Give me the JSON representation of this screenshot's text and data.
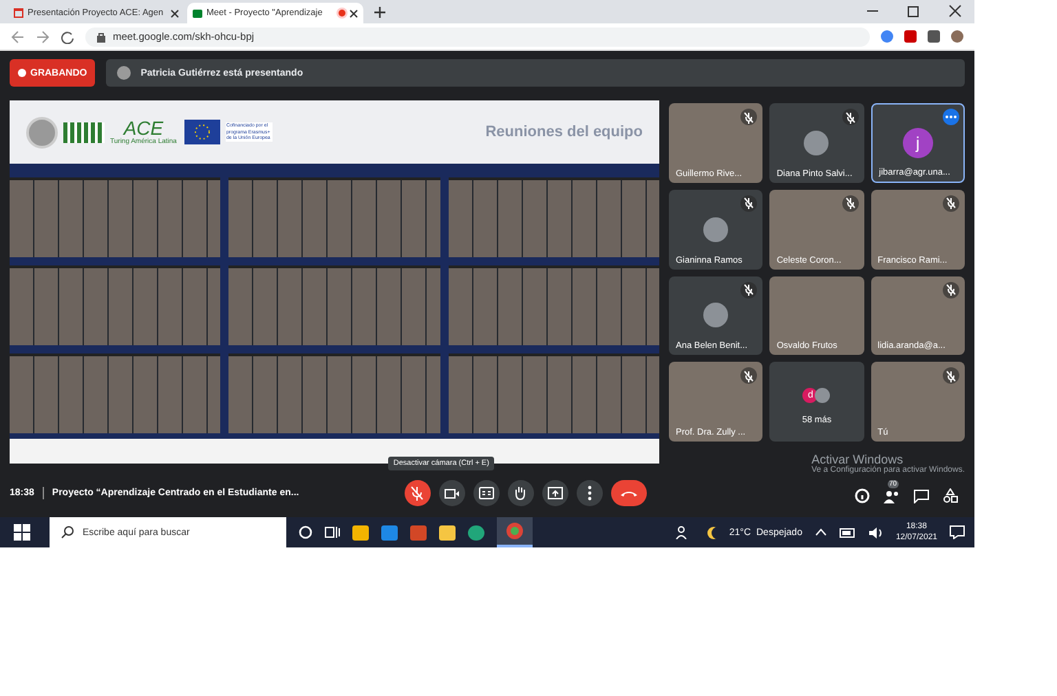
{
  "browser": {
    "tabs": [
      {
        "title": "Presentación Proyecto ACE: Agen",
        "selected": false
      },
      {
        "title": "Meet - Proyecto \"Aprendizaje",
        "selected": true
      }
    ],
    "url": "meet.google.com/skh-ohcu-bpj"
  },
  "meeting": {
    "recording_label": "GRABANDO",
    "presenter_text": "Patricia Gutiérrez está presentando"
  },
  "slide": {
    "logo_text": "ACE",
    "logo_subtitle": "Turing América Latina",
    "eu_text": "Cofinanciado por el programa Erasmus+ de la Unión Europea",
    "title": "Reuniones del equipo"
  },
  "participants": [
    {
      "name": "Guillermo Rive...",
      "kind": "video",
      "muted": true,
      "selected": false
    },
    {
      "name": "Diana Pinto Salvi...",
      "kind": "avatar",
      "muted": true,
      "selected": false
    },
    {
      "name": "jibarra@agr.una...",
      "kind": "letter",
      "letter": "j",
      "color": "#a142c4",
      "muted": false,
      "selected": true
    },
    {
      "name": "Gianinna Ramos",
      "kind": "avatar",
      "muted": true,
      "selected": false
    },
    {
      "name": "Celeste Coron...",
      "kind": "video",
      "muted": true,
      "selected": false
    },
    {
      "name": "Francisco Rami...",
      "kind": "video",
      "muted": true,
      "selected": false
    },
    {
      "name": "Ana Belen Benit...",
      "kind": "avatar",
      "muted": true,
      "selected": false
    },
    {
      "name": "Osvaldo Frutos",
      "kind": "video",
      "muted": false,
      "selected": false
    },
    {
      "name": "lidia.aranda@a...",
      "kind": "video",
      "muted": true,
      "selected": false
    },
    {
      "name": "Prof. Dra. Zully ...",
      "kind": "video",
      "muted": true,
      "selected": false
    },
    {
      "name": "58 más",
      "kind": "more",
      "letter": "d",
      "color": "#d81b60",
      "muted": false,
      "selected": false
    },
    {
      "name": "Tú",
      "kind": "video",
      "muted": true,
      "selected": false
    }
  ],
  "bottom_bar": {
    "time": "18:38",
    "meeting_title": "Proyecto “Aprendizaje Centrado en el Estudiante en...",
    "tooltip": "Desactivar cámara (Ctrl + E)",
    "mic_muted": true,
    "people_count": "70"
  },
  "activation": {
    "title": "Activar Windows",
    "text": "Ve a Configuración para activar Windows."
  },
  "taskbar": {
    "search_placeholder": "Escribe aquí para buscar",
    "temperature": "21°C",
    "weather": "Despejado",
    "time": "18:38",
    "date": "12/07/2021"
  }
}
